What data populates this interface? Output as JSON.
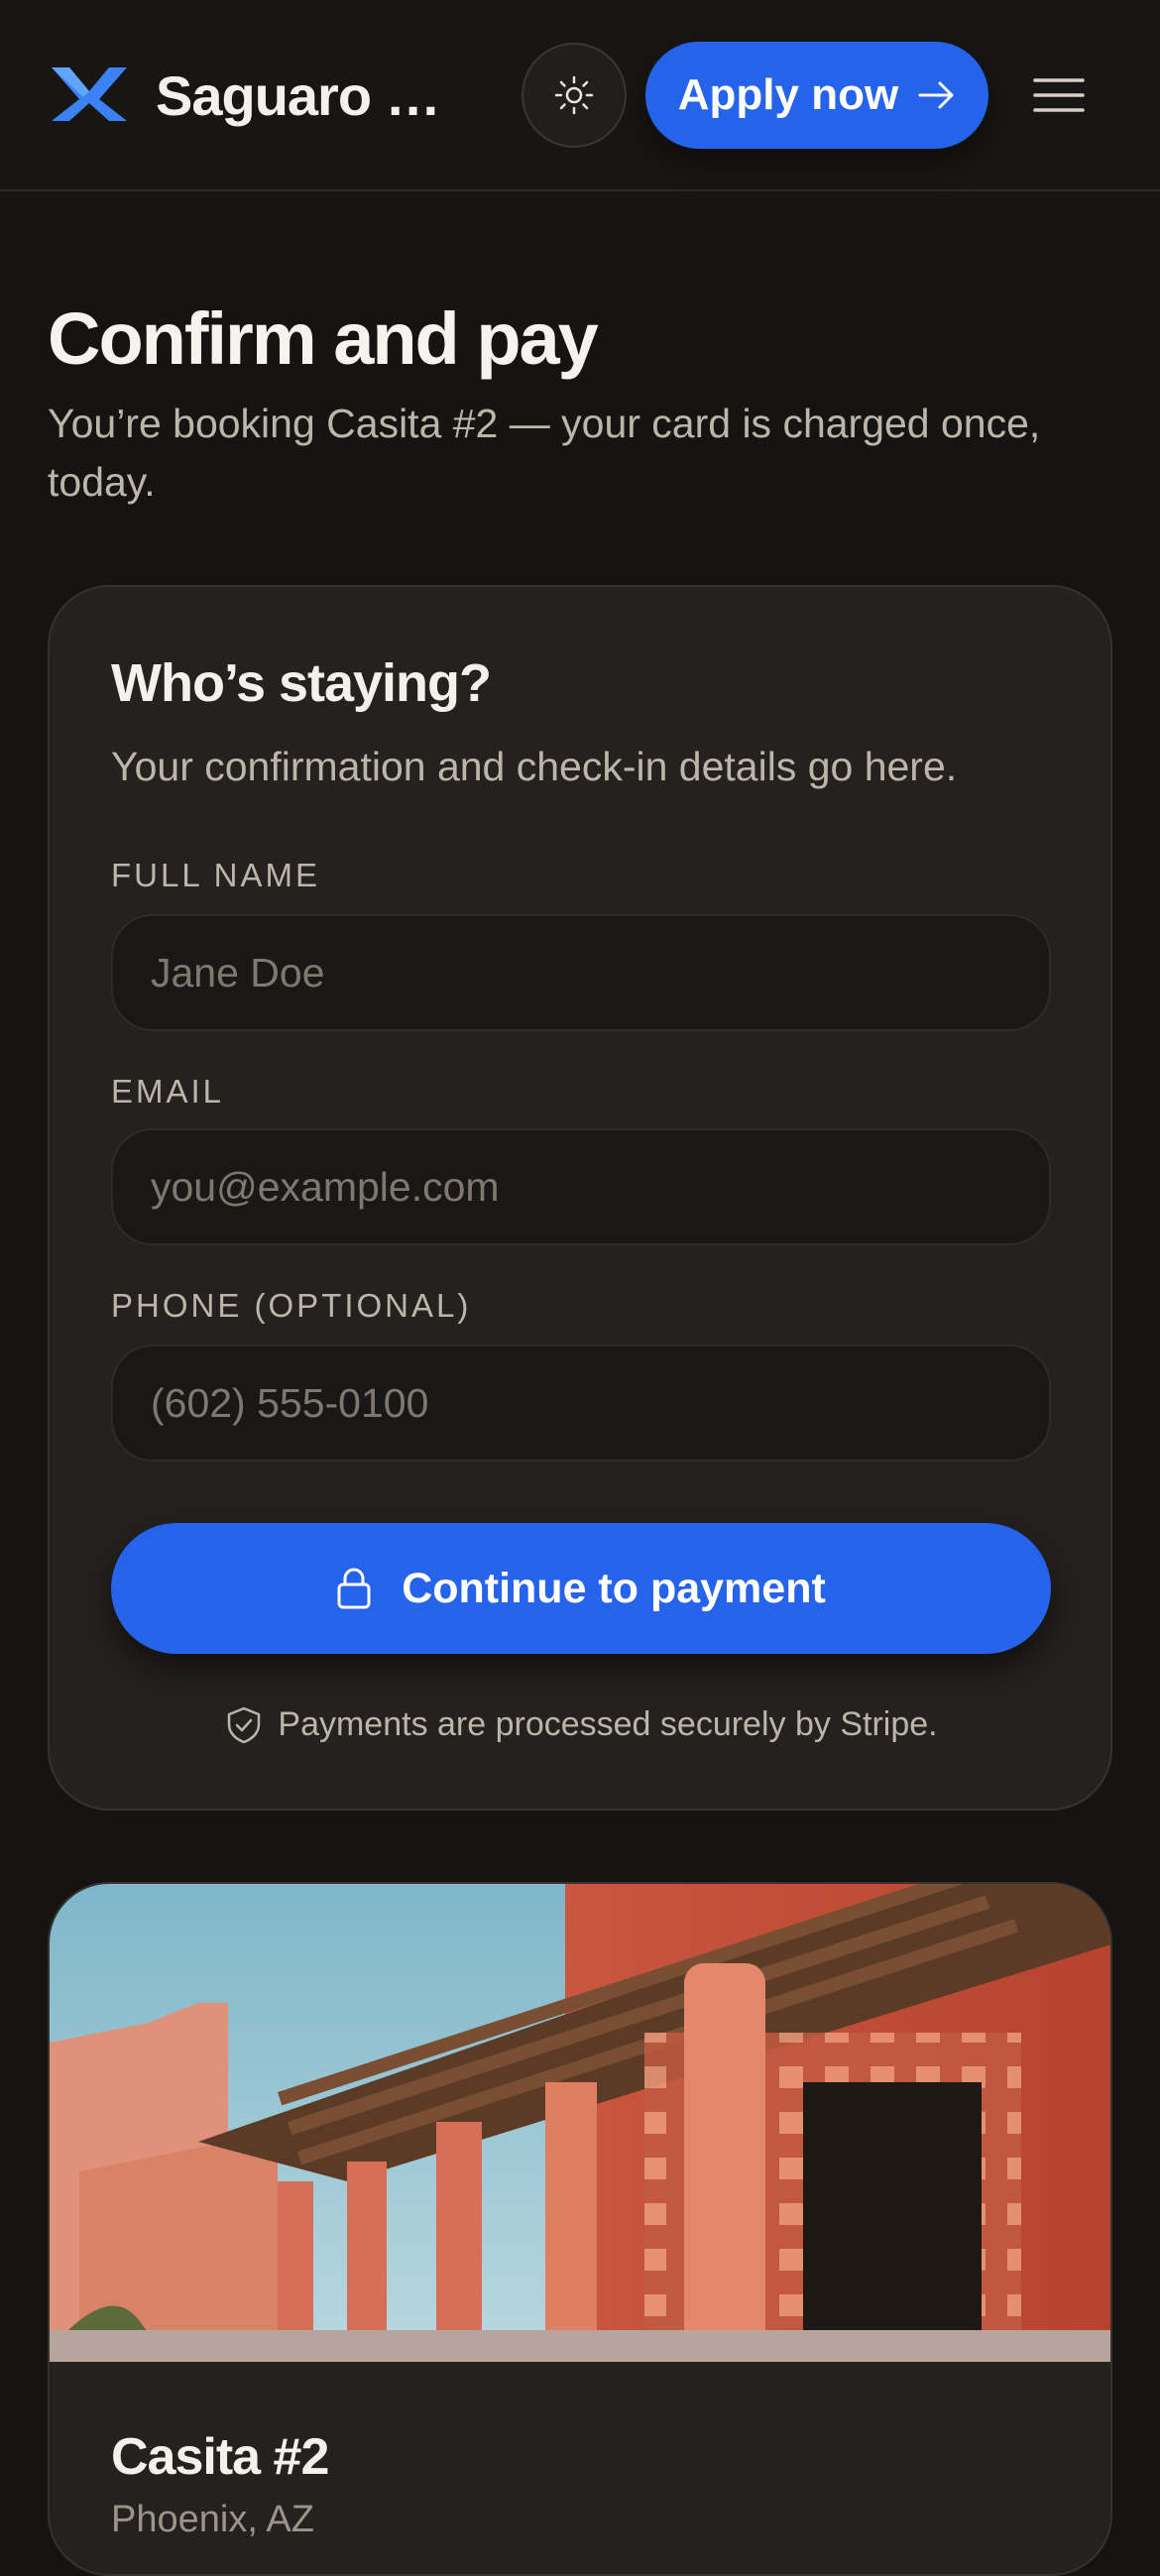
{
  "header": {
    "brand": "Saguaro Pr…",
    "apply_label": "Apply now",
    "icons": [
      "logo-icon",
      "sun-icon",
      "arrow-right-icon",
      "hamburger-menu-icon"
    ]
  },
  "page": {
    "title": "Confirm and pay",
    "subtitle": "You’re booking Casita #2 — your card is charged once, today."
  },
  "guest_form": {
    "title": "Who’s staying?",
    "subtitle": "Your confirmation and check-in details go here.",
    "fields": [
      {
        "label": "FULL NAME",
        "placeholder": "Jane Doe",
        "value": ""
      },
      {
        "label": "EMAIL",
        "placeholder": "you@example.com",
        "value": ""
      },
      {
        "label": "PHONE (OPTIONAL)",
        "placeholder": "(602) 555-0100",
        "value": ""
      }
    ],
    "submit_label": "Continue to payment",
    "secure_note": "Payments are processed securely by Stripe."
  },
  "listing": {
    "title": "Casita #2",
    "subtitle": "Phoenix, AZ"
  },
  "colors": {
    "background": "#161413",
    "card": "#24211e",
    "accent": "#2563eb",
    "text_primary": "#f4f1ec",
    "text_secondary": "#bcb5aa"
  }
}
